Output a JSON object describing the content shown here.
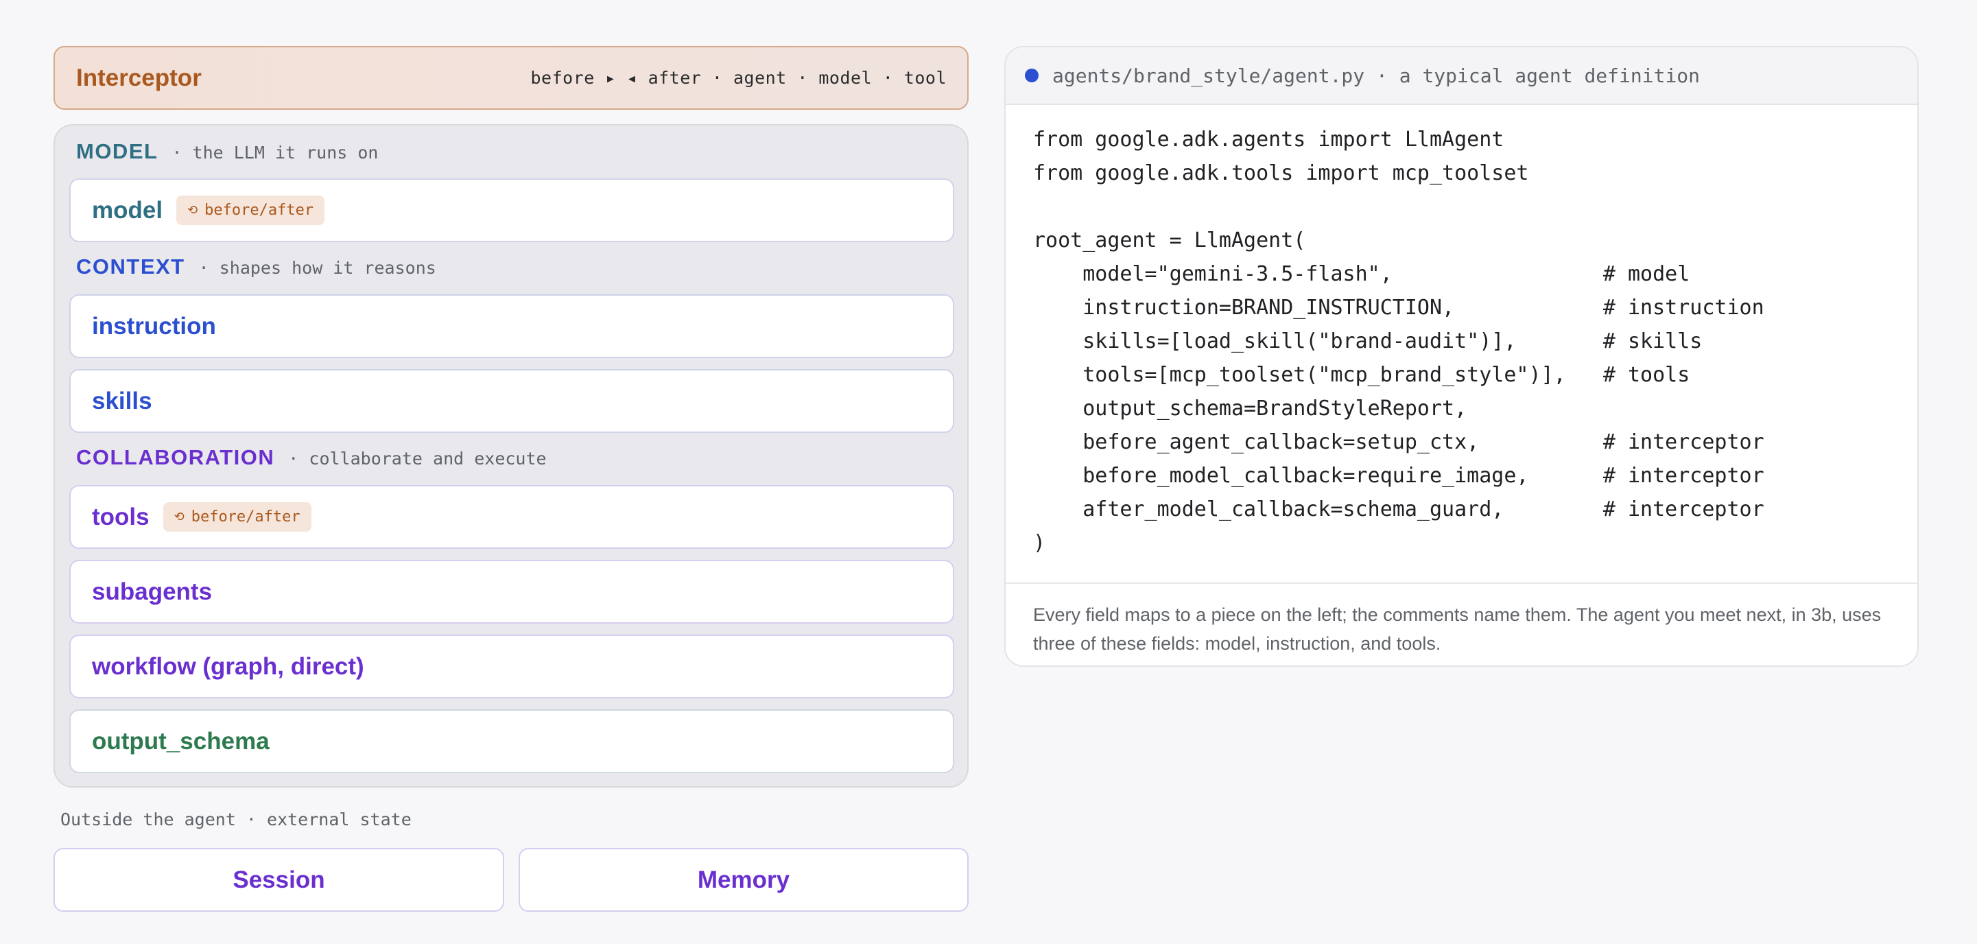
{
  "interceptor": {
    "title": "Interceptor",
    "flow": "before ▸ ◂ after · agent · model · tool"
  },
  "sections": {
    "model": {
      "name": "MODEL",
      "desc": "· the LLM it runs on"
    },
    "context": {
      "name": "CONTEXT",
      "desc": "· shapes how it reasons"
    },
    "collaboration": {
      "name": "COLLABORATION",
      "desc": "· collaborate and execute"
    }
  },
  "cards": {
    "model": {
      "name": "model",
      "badge": "before/after"
    },
    "instruction": {
      "name": "instruction"
    },
    "skills": {
      "name": "skills"
    },
    "tools": {
      "name": "tools",
      "badge": "before/after"
    },
    "subagents": {
      "name": "subagents"
    },
    "workflow": {
      "name": "workflow (graph, direct)"
    },
    "output_schema": {
      "name": "output_schema"
    }
  },
  "outside": {
    "label": "Outside the agent · external state",
    "session": "Session",
    "memory": "Memory"
  },
  "code": {
    "title": "agents/brand_style/agent.py · a typical agent definition",
    "lines": [
      "from google.adk.agents import LlmAgent",
      "from google.adk.tools import mcp_toolset",
      "",
      "root_agent = LlmAgent(",
      "    model=\"gemini-3.5-flash\",                 # model",
      "    instruction=BRAND_INSTRUCTION,            # instruction",
      "    skills=[load_skill(\"brand-audit\")],       # skills",
      "    tools=[mcp_toolset(\"mcp_brand_style\")],   # tools",
      "    output_schema=BrandStyleReport,",
      "    before_agent_callback=setup_ctx,          # interceptor",
      "    before_model_callback=require_image,      # interceptor",
      "    after_model_callback=schema_guard,        # interceptor",
      ")"
    ],
    "footer": "Every field maps to a piece on the left; the comments name them. The agent you meet next, in 3b, uses three of these fields: model, instruction, and tools."
  },
  "colors": {
    "interceptor": "#a9591f",
    "model": "#2f6f83",
    "context": "#2c4fcf",
    "collaboration": "#6a2fcf",
    "output_schema": "#2e7a4f"
  }
}
